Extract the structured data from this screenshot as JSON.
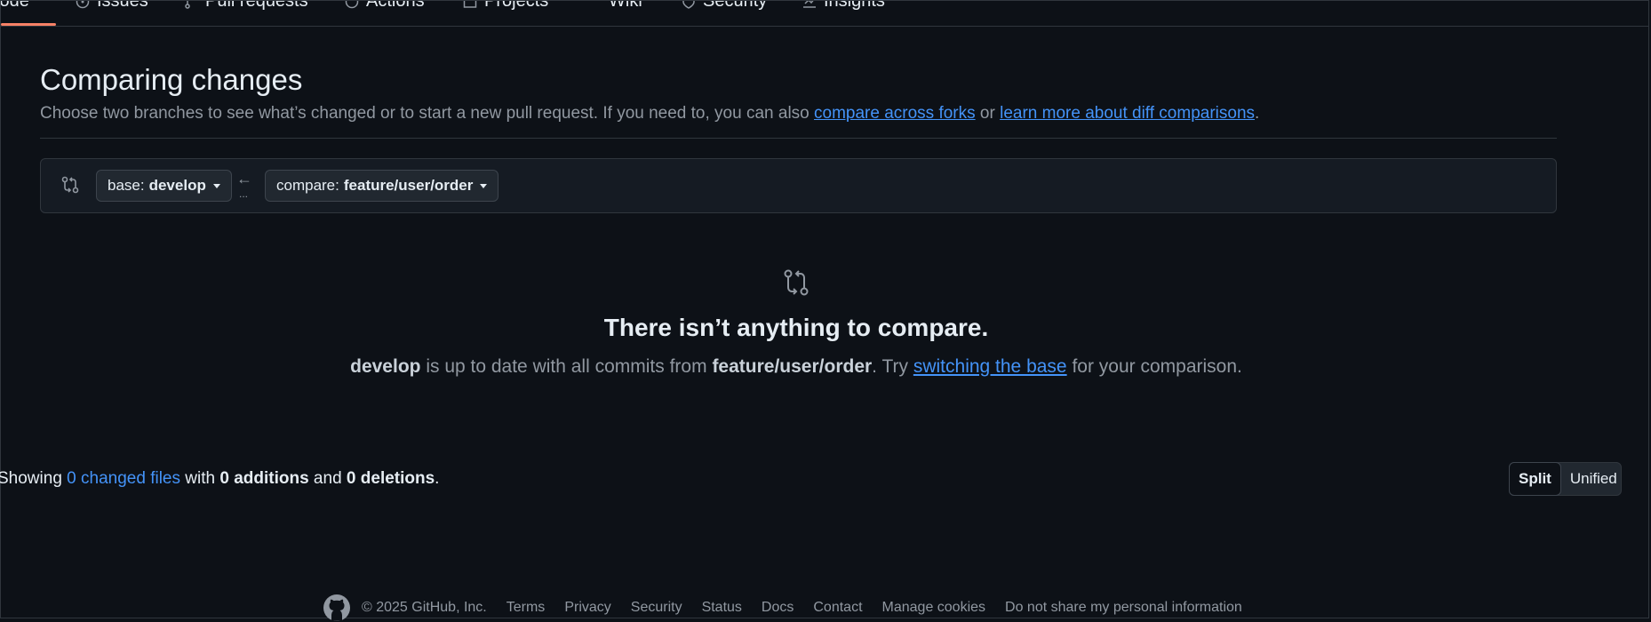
{
  "nav": {
    "tabs": [
      {
        "label": "Code",
        "icon": "code-icon"
      },
      {
        "label": "Issues",
        "icon": "issue-icon"
      },
      {
        "label": "Pull requests",
        "icon": "pull-request-icon"
      },
      {
        "label": "Actions",
        "icon": "play-icon"
      },
      {
        "label": "Projects",
        "icon": "table-icon"
      },
      {
        "label": "Wiki",
        "icon": "book-icon"
      },
      {
        "label": "Security",
        "icon": "shield-icon"
      },
      {
        "label": "Insights",
        "icon": "graph-icon"
      }
    ],
    "active": "Code"
  },
  "header": {
    "title": "Comparing changes",
    "subtitle_prefix": "Choose two branches to see what’s changed or to start a new pull request. If you need to, you can also ",
    "link_forks": "compare across forks",
    "subtitle_or": " or ",
    "link_learn": "learn more about diff comparisons",
    "subtitle_end": "."
  },
  "range": {
    "base_prefix": "base:",
    "base_branch": "develop",
    "compare_prefix": "compare:",
    "compare_branch": "feature/user/order",
    "arrow": "←",
    "dots": "..."
  },
  "blank": {
    "heading": "There isn’t anything to compare.",
    "base": "develop",
    "mid": " is up to date with all commits from ",
    "compare": "feature/user/order",
    "try": ". Try ",
    "link": "switching the base",
    "end": " for your comparison."
  },
  "summary": {
    "showing": "Showing ",
    "files": "0 changed files",
    "with": " with ",
    "additions": "0 additions",
    "and": " and ",
    "deletions": "0 deletions",
    "end": "."
  },
  "view_toggle": {
    "split": "Split",
    "unified": "Unified",
    "selected": "Split"
  },
  "footer": {
    "copyright": "© 2025 GitHub, Inc.",
    "links": [
      "Terms",
      "Privacy",
      "Security",
      "Status",
      "Docs",
      "Contact",
      "Manage cookies",
      "Do not share my personal information"
    ]
  },
  "colors": {
    "background": "#0d1117",
    "accent_link": "#4493f8",
    "active_tab_underline": "#f78166",
    "muted_text": "#9198a1"
  }
}
